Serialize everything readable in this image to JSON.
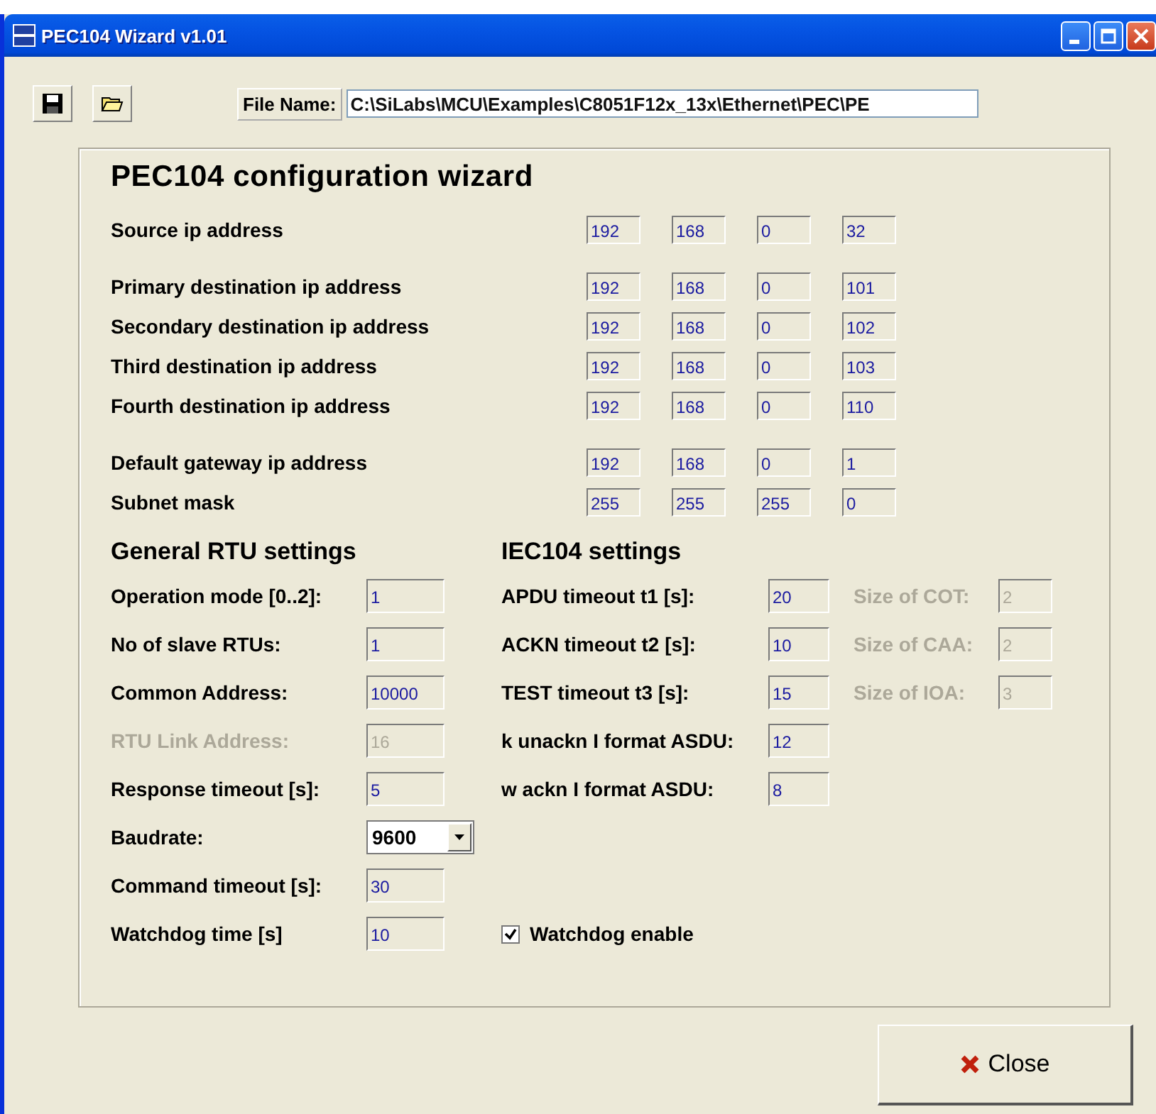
{
  "window": {
    "title": "PEC104 Wizard v1.01"
  },
  "toolbar": {
    "file_name_label": "File Name:",
    "file_name": "C:\\SiLabs\\MCU\\Examples\\C8051F12x_13x\\Ethernet\\PEC\\PE"
  },
  "heading": "PEC104 configuration wizard",
  "ip_groups": [
    {
      "rows": [
        {
          "label": "Source ip address",
          "octets": [
            "192",
            "168",
            "0",
            "32"
          ]
        }
      ]
    },
    {
      "rows": [
        {
          "label": "Primary destination ip address",
          "octets": [
            "192",
            "168",
            "0",
            "101"
          ]
        },
        {
          "label": "Secondary destination ip address",
          "octets": [
            "192",
            "168",
            "0",
            "102"
          ]
        },
        {
          "label": "Third destination ip address",
          "octets": [
            "192",
            "168",
            "0",
            "103"
          ]
        },
        {
          "label": "Fourth destination ip address",
          "octets": [
            "192",
            "168",
            "0",
            "110"
          ]
        }
      ]
    },
    {
      "rows": [
        {
          "label": "Default gateway ip address",
          "octets": [
            "192",
            "168",
            "0",
            "1"
          ]
        },
        {
          "label": "Subnet mask",
          "octets": [
            "255",
            "255",
            "255",
            "0"
          ]
        }
      ]
    }
  ],
  "rtu": {
    "title": "General RTU settings",
    "fields": [
      {
        "kind": "text",
        "label": "Operation mode [0..2]:",
        "value": "1",
        "disabled": false
      },
      {
        "kind": "text",
        "label": "No of slave RTUs:",
        "value": "1",
        "disabled": false
      },
      {
        "kind": "text",
        "label": "Common Address:",
        "value": "10000",
        "disabled": false
      },
      {
        "kind": "text",
        "label": "RTU Link Address:",
        "value": "16",
        "disabled": true
      },
      {
        "kind": "text",
        "label": "Response timeout [s]:",
        "value": "5",
        "disabled": false
      },
      {
        "kind": "dropdown",
        "label": "Baudrate:",
        "value": "9600",
        "disabled": false
      },
      {
        "kind": "text",
        "label": "Command timeout [s]:",
        "value": "30",
        "disabled": false
      },
      {
        "kind": "text",
        "label": "Watchdog time [s]",
        "value": "10",
        "disabled": false
      }
    ]
  },
  "iec": {
    "title": "IEC104 settings",
    "fields": [
      {
        "label": "APDU timeout t1 [s]:",
        "value": "20",
        "extra": {
          "label": "Size of COT:",
          "value": "2",
          "disabled": true
        }
      },
      {
        "label": "ACKN timeout  t2 [s]:",
        "value": "10",
        "extra": {
          "label": "Size of CAA:",
          "value": "2",
          "disabled": true
        }
      },
      {
        "label": "TEST timeout t3 [s]:",
        "value": "15",
        "extra": {
          "label": "Size of IOA:",
          "value": "3",
          "disabled": true
        }
      },
      {
        "label": "k unackn I format ASDU:",
        "value": "12"
      },
      {
        "label": "w ackn I format ASDU:",
        "value": "8"
      }
    ]
  },
  "watchdog": {
    "label": "Watchdog enable",
    "checked": true
  },
  "close_button": {
    "label": "Close"
  }
}
